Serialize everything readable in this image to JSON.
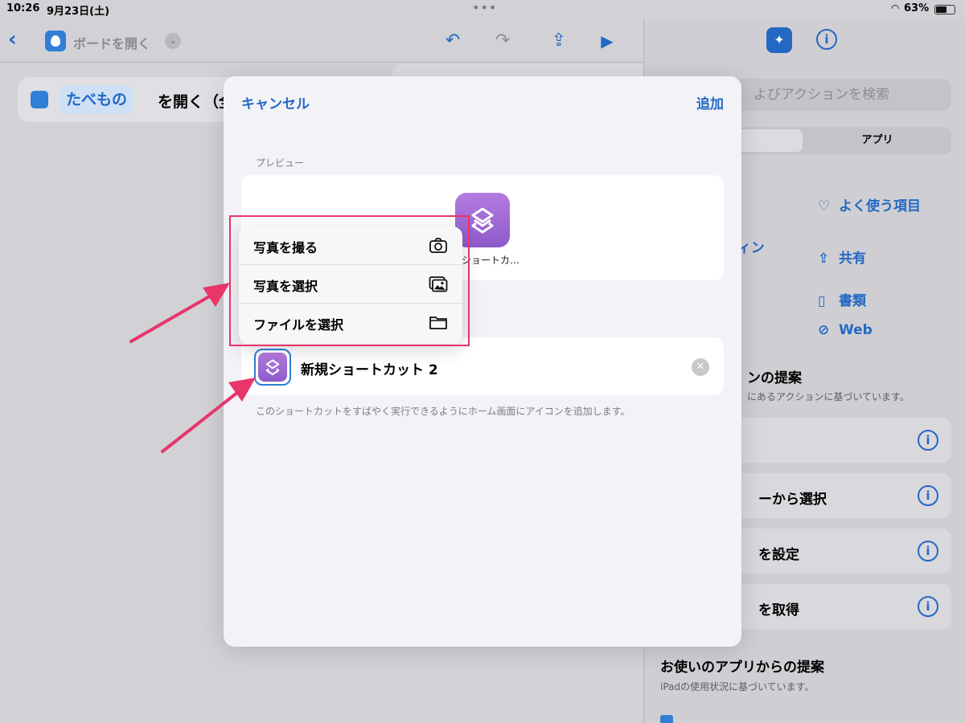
{
  "status_bar": {
    "time": "10:26",
    "date": "9月23日(土)",
    "battery": "63%"
  },
  "editor": {
    "title": "ボードを開く",
    "action": {
      "token": "たべもの",
      "text": "を開く（全画"
    }
  },
  "right_panel": {
    "search_placeholder": "よびアクションを検索",
    "segments": [
      "リ",
      "アプリ"
    ],
    "categories": [
      {
        "label": "よく使う項目",
        "icon": "heart-icon"
      },
      {
        "label": "共有",
        "icon": "share-icon"
      },
      {
        "label": "書類",
        "icon": "document-icon"
      },
      {
        "label": "Web",
        "icon": "compass-icon"
      }
    ],
    "partial_categories": [
      "ン",
      "ディン",
      "ン"
    ],
    "suggestions_heading": "ンの提案",
    "suggestions_sub": "にあるアクションに基づいています。",
    "suggestions": [
      "",
      "ーから選択",
      "を設定",
      "を取得"
    ],
    "app_heading": "お使いのアプリからの提案",
    "app_sub": "iPadの使用状況に基づいています。"
  },
  "modal": {
    "cancel": "キャンセル",
    "add": "追加",
    "preview_label": "プレビュー",
    "preview_icon_label": "ショートカ…",
    "name": "新規ショートカット 2",
    "footnote": "このショートカットをすばやく実行できるようにホーム画面にアイコンを追加します。"
  },
  "context_menu": {
    "items": [
      {
        "label": "写真を撮る",
        "icon": "camera-icon"
      },
      {
        "label": "写真を選択",
        "icon": "photo-library-icon"
      },
      {
        "label": "ファイルを選択",
        "icon": "folder-icon"
      }
    ]
  },
  "colors": {
    "accent": "#2468c4",
    "annotation": "#e8356a",
    "shortcut_icon": "#a46cd6"
  }
}
